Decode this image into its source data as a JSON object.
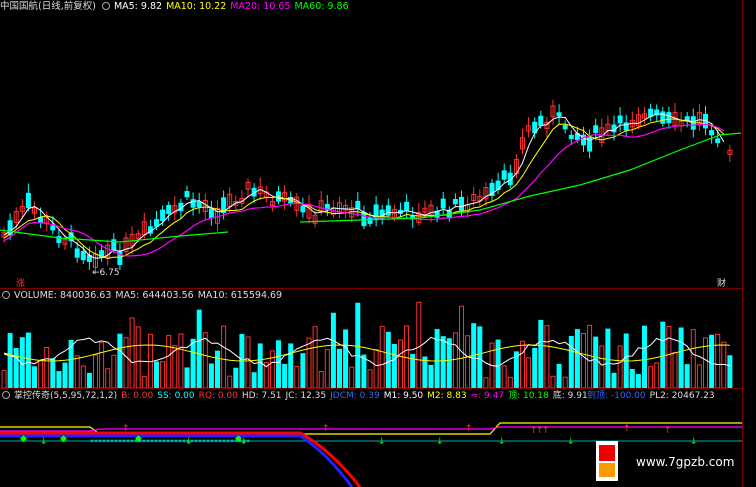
{
  "price_panel": {
    "title": "中国国航(日线,前复权)",
    "ma5": "MA5: 9.82",
    "ma10": "MA10: 10.22",
    "ma20": "MA20: 10.65",
    "ma60": "MA60: 9.86",
    "low_label": "6.75",
    "left_tag": "涨",
    "right_tag": "财",
    "colors": {
      "ma5": "#ffffff",
      "ma10": "#ffff00",
      "ma20": "#ff00ff",
      "ma60": "#00ff00",
      "up": "#ff3030",
      "down": "#00ffff"
    }
  },
  "volume_panel": {
    "volume": "VOLUME: 840036.63",
    "ma5": "MA5: 644403.56",
    "ma10": "MA10: 615594.69"
  },
  "indicator_panel": {
    "name": "掌控传奇(5,5,95,72,1,2)",
    "b": "B: 0.00",
    "ss": "SS: 0.00",
    "rq": "RQ: 0.00",
    "hd": "HD: 7.51",
    "jc": "JC: 12.35",
    "jdcm": "JDCM: 0.39",
    "m1": "M1: 9.50",
    "m2": "M2: 8.83",
    "x": "≈: 9.47",
    "ding": "顶: 10.18",
    "di": "底: 9.91",
    "wave": "到顶: -100.00",
    "pl2": "PL2: 20467.23"
  },
  "watermark": {
    "text": "www.7gpzb.com"
  }
}
